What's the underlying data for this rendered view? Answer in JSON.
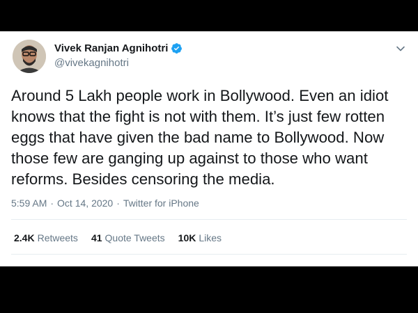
{
  "tweet": {
    "author": {
      "name": "Vivek Ranjan Agnihotri",
      "handle": "@vivekagnihotri",
      "verified": true
    },
    "text": "Around 5 Lakh people work in Bollywood. Even an idiot knows that the fight is not with them. It’s just few rotten eggs that have given the bad name to Bollywood. Now those few are ganging up against to those who want reforms. Besides censoring the media.",
    "time": "5:59 AM",
    "date": "Oct 14, 2020",
    "separator": "·",
    "source": "Twitter for iPhone",
    "stats": {
      "retweets": {
        "count": "2.4K",
        "label": "Retweets"
      },
      "quote_tweets": {
        "count": "41",
        "label": "Quote Tweets"
      },
      "likes": {
        "count": "10K",
        "label": "Likes"
      }
    }
  },
  "icons": {
    "verified": "verified-badge-icon",
    "menu": "chevron-down-icon"
  },
  "colors": {
    "background": "#000000",
    "card": "#ffffff",
    "text_primary": "#14171a",
    "text_secondary": "#657786",
    "verified_blue": "#1da1f2",
    "divider": "#e6ecf0"
  }
}
